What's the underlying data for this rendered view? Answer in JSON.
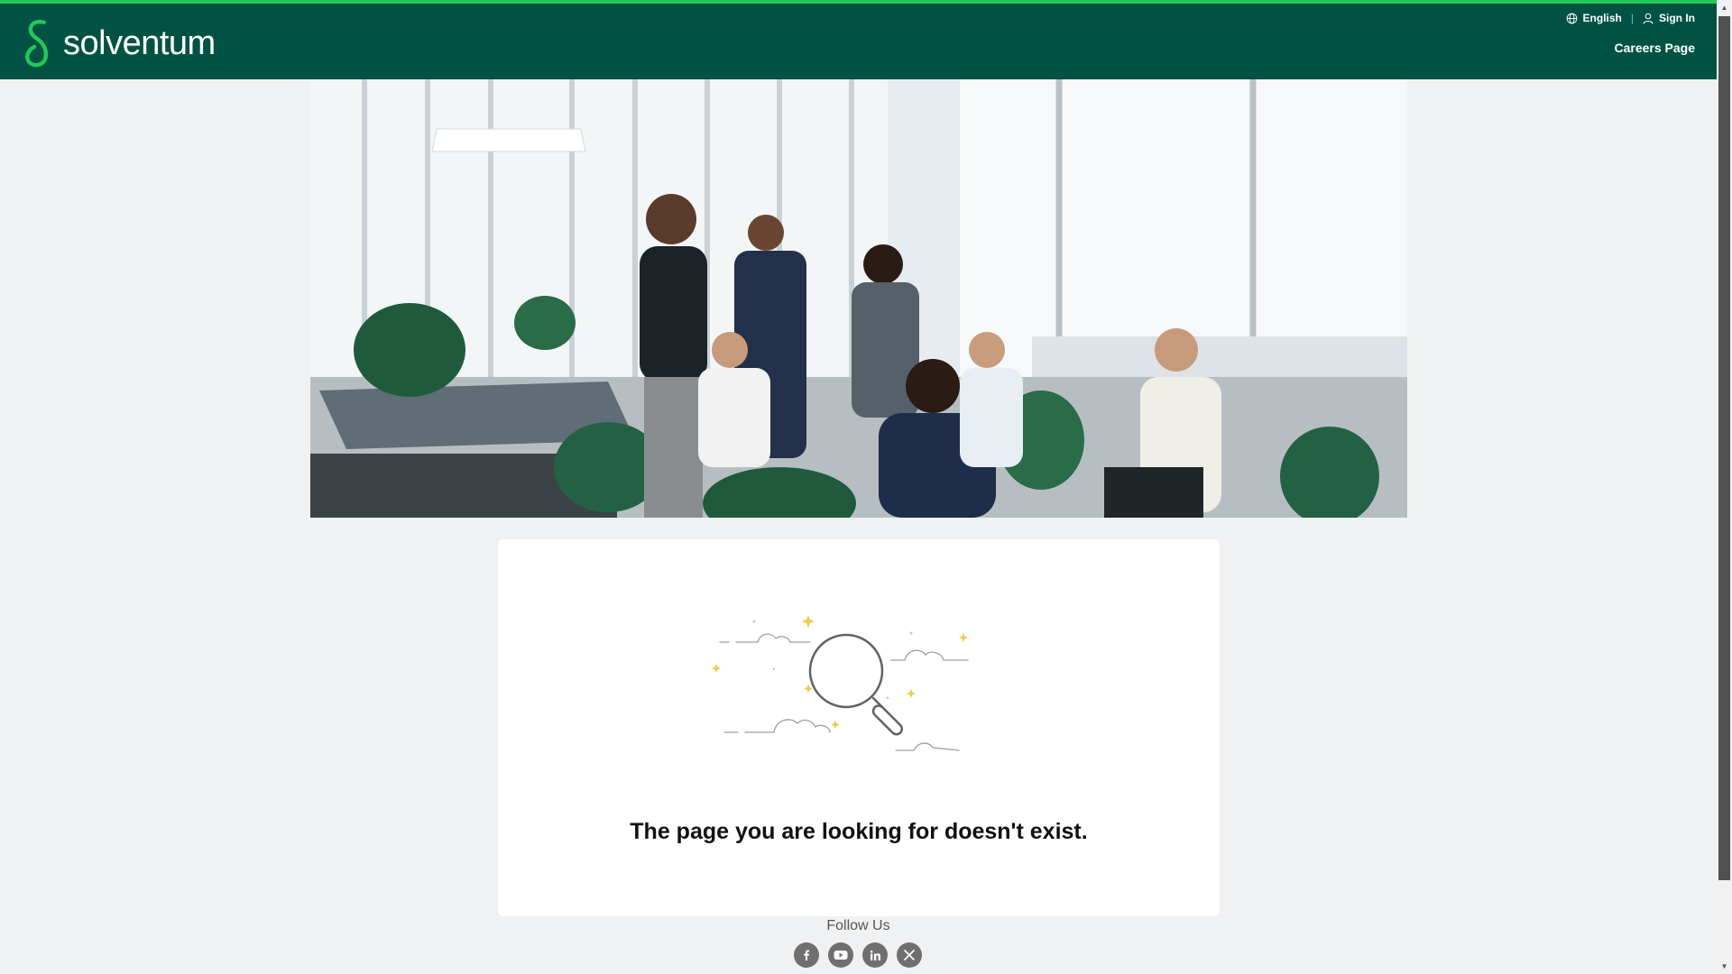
{
  "header": {
    "brand": "solventum",
    "language_label": "English",
    "signin_label": "Sign In",
    "careers_label": "Careers Page",
    "colors": {
      "bar": "#005343",
      "accent": "#21c95b"
    }
  },
  "hero": {
    "alt": "Group of colleagues meeting in a bright modern office lounge"
  },
  "error": {
    "illustration": "magnifier-search-icon",
    "message": "The page you are looking for doesn't exist."
  },
  "footer": {
    "follow_label": "Follow Us",
    "social": [
      "facebook-icon",
      "youtube-icon",
      "linkedin-icon",
      "x-icon"
    ]
  }
}
